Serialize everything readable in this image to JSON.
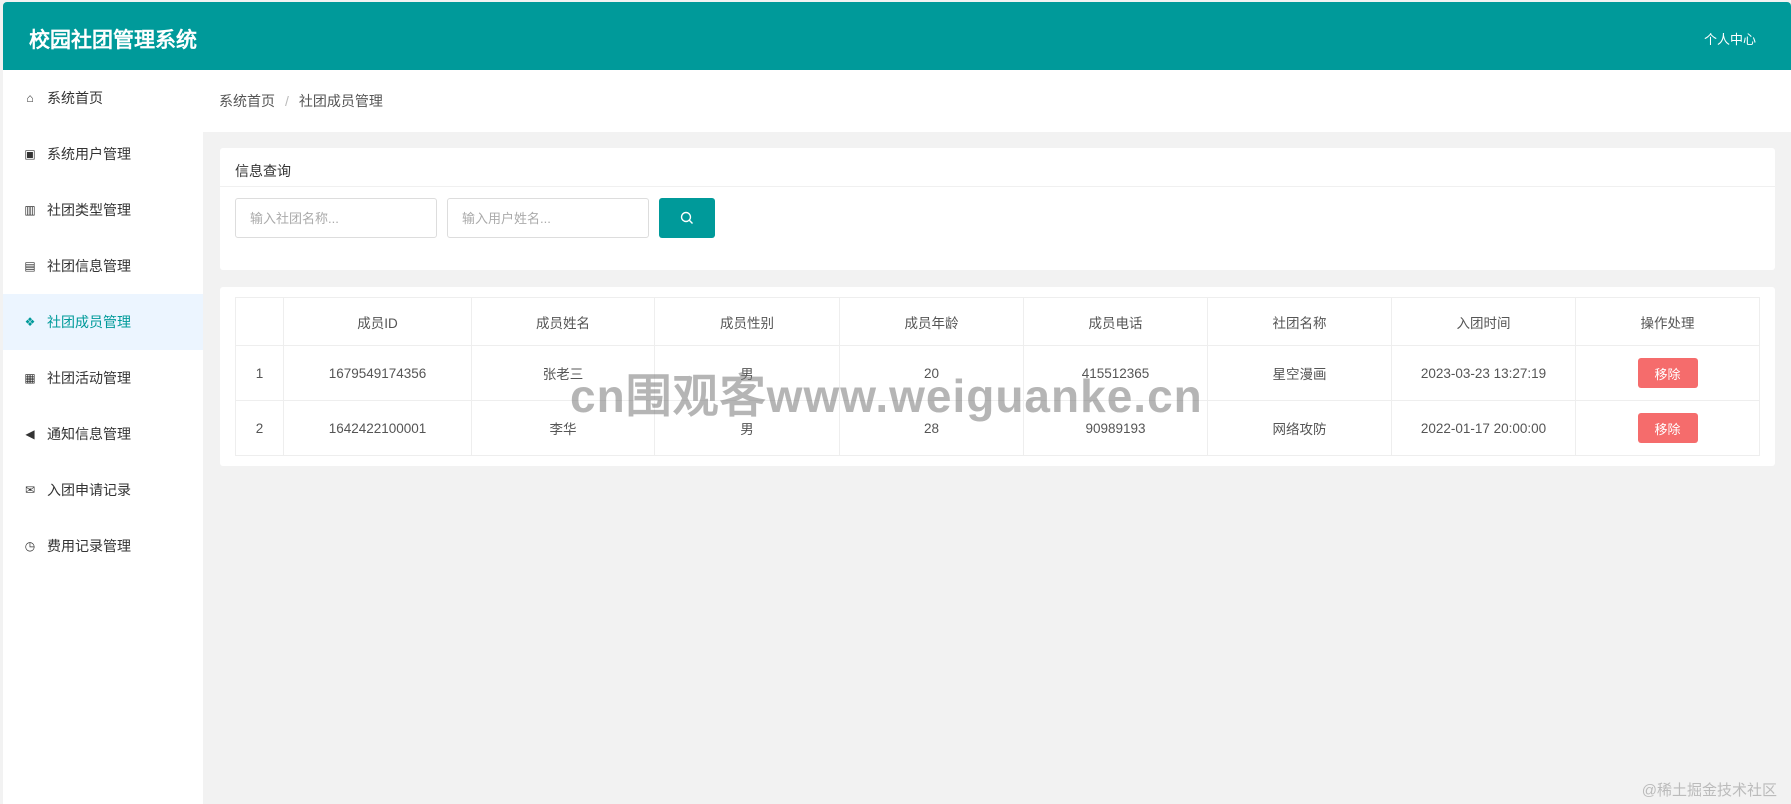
{
  "header": {
    "title": "校园社团管理系统",
    "user_center": "个人中心"
  },
  "sidebar": {
    "items": [
      {
        "label": "系统首页",
        "icon": "home-icon",
        "glyph": "⌂"
      },
      {
        "label": "系统用户管理",
        "icon": "address-book-icon",
        "glyph": "▣"
      },
      {
        "label": "社团类型管理",
        "icon": "building-icon",
        "glyph": "▥"
      },
      {
        "label": "社团信息管理",
        "icon": "train-icon",
        "glyph": "▤"
      },
      {
        "label": "社团成员管理",
        "icon": "cubes-icon",
        "glyph": "❖",
        "active": true
      },
      {
        "label": "社团活动管理",
        "icon": "calculator-icon",
        "glyph": "▦"
      },
      {
        "label": "通知信息管理",
        "icon": "bullhorn-icon",
        "glyph": "◀"
      },
      {
        "label": "入团申请记录",
        "icon": "envelope-open-icon",
        "glyph": "✉"
      },
      {
        "label": "费用记录管理",
        "icon": "clock-icon",
        "glyph": "◷"
      }
    ]
  },
  "breadcrumb": {
    "home": "系统首页",
    "current": "社团成员管理"
  },
  "search": {
    "title": "信息查询",
    "club_placeholder": "输入社团名称...",
    "user_placeholder": "输入用户姓名..."
  },
  "table": {
    "columns": [
      "",
      "成员ID",
      "成员姓名",
      "成员性别",
      "成员年龄",
      "成员电话",
      "社团名称",
      "入团时间",
      "操作处理"
    ],
    "rows": [
      [
        "1",
        "1679549174356",
        "张老三",
        "男",
        "20",
        "415512365",
        "星空漫画",
        "2023-03-23 13:27:19"
      ],
      [
        "2",
        "1642422100001",
        "李华",
        "男",
        "28",
        "90989193",
        "网络攻防",
        "2022-01-17 20:00:00"
      ]
    ],
    "remove_label": "移除"
  },
  "watermark": "cn围观客www.weiguanke.cn",
  "credit": "@稀土掘金技术社区",
  "colors": {
    "primary": "#009a9a",
    "danger": "#f56c6c"
  }
}
